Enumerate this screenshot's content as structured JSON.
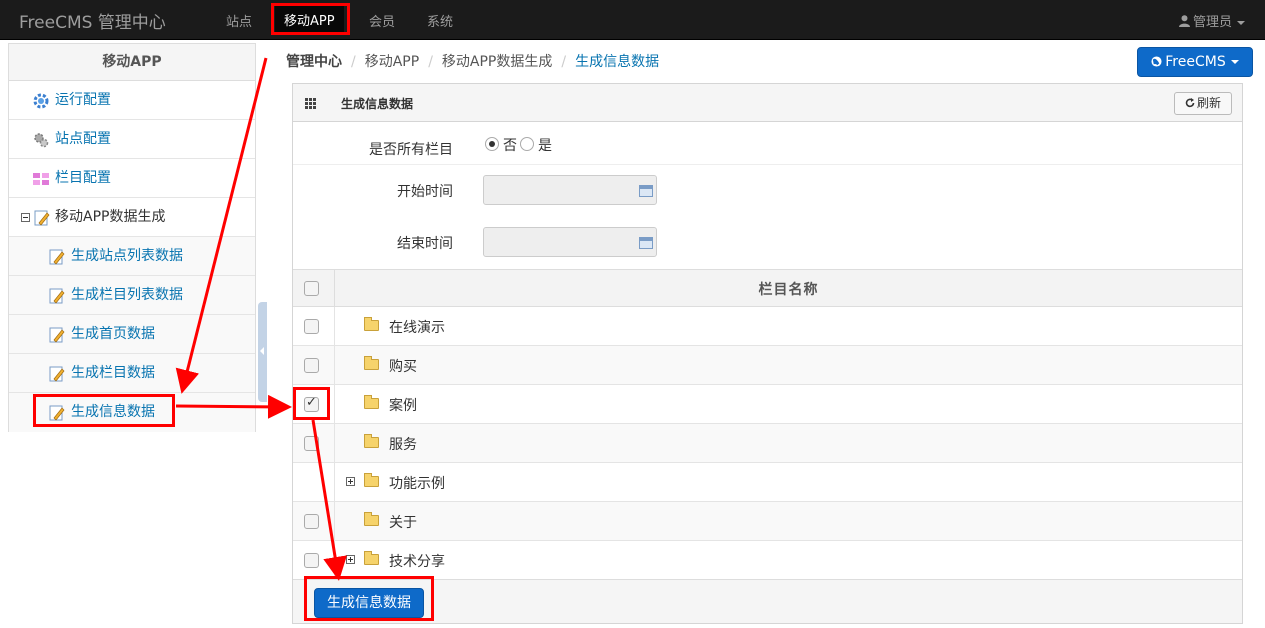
{
  "navbar": {
    "brand": "FreeCMS 管理中心",
    "items": [
      {
        "label": "站点"
      },
      {
        "label": "移动APP"
      },
      {
        "label": "会员"
      },
      {
        "label": "系统"
      }
    ],
    "user": "管理员"
  },
  "sidebar": {
    "title": "移动APP",
    "items": [
      {
        "label": "运行配置",
        "icon": "gear-blue-icon"
      },
      {
        "label": "站点配置",
        "icon": "gears-icon"
      },
      {
        "label": "栏目配置",
        "icon": "columns-icon"
      },
      {
        "label": "移动APP数据生成",
        "icon": "edit-icon"
      },
      {
        "label": "生成站点列表数据",
        "icon": "edit-icon"
      },
      {
        "label": "生成栏目列表数据",
        "icon": "edit-icon"
      },
      {
        "label": "生成首页数据",
        "icon": "edit-icon"
      },
      {
        "label": "生成栏目数据",
        "icon": "edit-icon"
      },
      {
        "label": "生成信息数据",
        "icon": "edit-icon"
      }
    ]
  },
  "breadcrumb": {
    "items": [
      "管理中心",
      "移动APP",
      "移动APP数据生成",
      "生成信息数据"
    ],
    "separator": "/"
  },
  "brand_button": "FreeCMS",
  "panel": {
    "title": "生成信息数据",
    "refresh_label": "刷新"
  },
  "form": {
    "all_columns_label": "是否所有栏目",
    "option_no": "否",
    "option_yes": "是",
    "start_time_label": "开始时间",
    "end_time_label": "结束时间"
  },
  "table": {
    "header": "栏目名称",
    "rows": [
      {
        "label": "在线演示",
        "checked": false
      },
      {
        "label": "购买",
        "checked": false
      },
      {
        "label": "案例",
        "checked": true
      },
      {
        "label": "服务",
        "checked": false
      },
      {
        "label": "功能示例",
        "checked": false
      },
      {
        "label": "关于",
        "checked": false
      },
      {
        "label": "技术分享",
        "checked": false
      }
    ]
  },
  "submit_label": "生成信息数据",
  "colors": {
    "annotation": "#ff0000",
    "primary": "#0e6ac9",
    "link": "#0874b0"
  }
}
